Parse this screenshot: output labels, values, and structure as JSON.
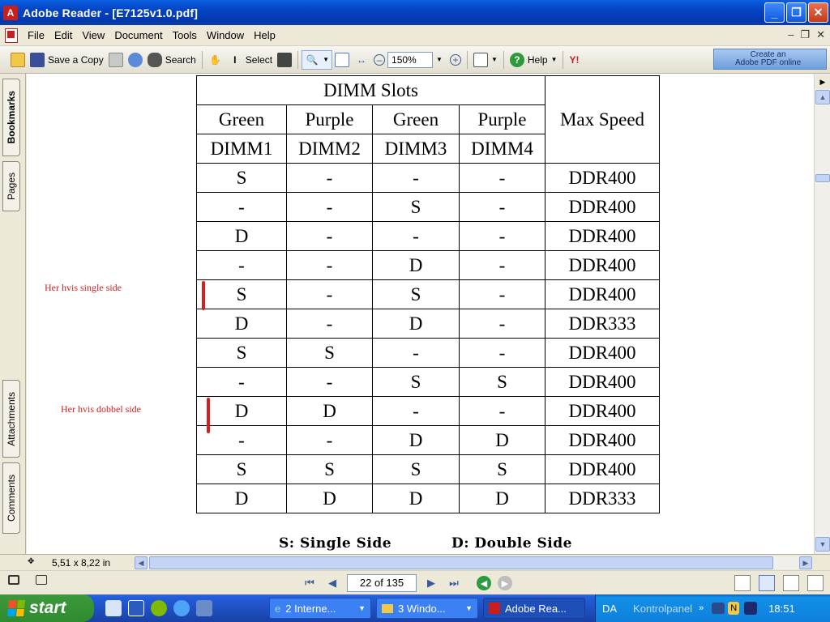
{
  "window": {
    "app_title": "Adobe Reader - [E7125v1.0.pdf]",
    "buttons": [
      "_",
      "❐",
      "✕"
    ]
  },
  "menu": {
    "items": [
      "File",
      "Edit",
      "View",
      "Document",
      "Tools",
      "Window",
      "Help"
    ],
    "doc_controls": [
      "–",
      "❐",
      "✕"
    ]
  },
  "toolbar": {
    "save_label": "Save a Copy",
    "search_label": "Search",
    "select_label": "Select",
    "zoom_value": "150%",
    "help_label": "Help",
    "create_line1": "Create an",
    "create_line2": "Adobe PDF online"
  },
  "nav_tabs": [
    "Bookmarks",
    "Pages",
    "Attachments",
    "Comments"
  ],
  "document": {
    "table": {
      "group_header": "DIMM Slots",
      "max_speed_header": "Max Speed",
      "colors": [
        "Green",
        "Purple",
        "Green",
        "Purple"
      ],
      "slots": [
        "DIMM1",
        "DIMM2",
        "DIMM3",
        "DIMM4"
      ],
      "rows": [
        [
          "S",
          "-",
          "-",
          "-",
          "DDR400"
        ],
        [
          "-",
          "-",
          "S",
          "-",
          "DDR400"
        ],
        [
          "D",
          "-",
          "-",
          "-",
          "DDR400"
        ],
        [
          "-",
          "-",
          "D",
          "-",
          "DDR400"
        ],
        [
          "S",
          "-",
          "S",
          "-",
          "DDR400"
        ],
        [
          "D",
          "-",
          "D",
          "-",
          "DDR333"
        ],
        [
          "S",
          "S",
          "-",
          "-",
          "DDR400"
        ],
        [
          "-",
          "-",
          "S",
          "S",
          "DDR400"
        ],
        [
          "D",
          "D",
          "-",
          "-",
          "DDR400"
        ],
        [
          "-",
          "-",
          "D",
          "D",
          "DDR400"
        ],
        [
          "S",
          "S",
          "S",
          "S",
          "DDR400"
        ],
        [
          "D",
          "D",
          "D",
          "D",
          "DDR333"
        ]
      ]
    },
    "legend_single": "S: Single Side",
    "legend_double": "D: Double Side",
    "annotations": {
      "single": "Her hvis single side",
      "double": "Her hvis dobbel side"
    }
  },
  "status": {
    "page_size": "5,51 x 8,22 in",
    "page_indicator": "22 of 135"
  },
  "taskbar": {
    "start_label": "start",
    "tasks": [
      "2 Interne...",
      "3 Windo...",
      "Adobe Rea..."
    ],
    "language": "DA",
    "tray_label": "Kontrolpanel",
    "time": "18:51"
  }
}
